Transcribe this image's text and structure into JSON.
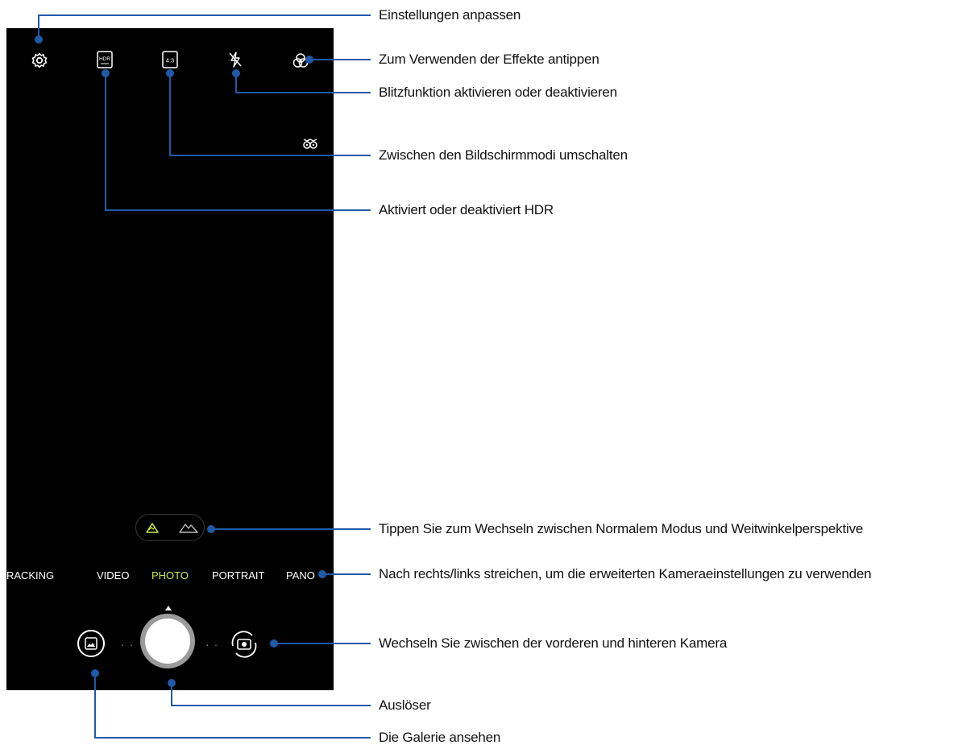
{
  "colors": {
    "screen": "#000000",
    "accent_mode": "#c6e84c",
    "callout": "#1f5aa8"
  },
  "icons": {
    "settings": "gear-icon",
    "hdr": "hdr-auto-icon",
    "ratio": "aspect-ratio-icon",
    "flash": "flash-off-icon",
    "effects": "effects-icon",
    "owl": "owl-icon",
    "lens_normal": "mountain-normal-icon",
    "lens_wide": "mountain-wide-icon",
    "gallery": "gallery-icon",
    "shutter": "shutter-icon",
    "switch": "switch-camera-icon"
  },
  "camera": {
    "ratio_label": "4:3",
    "hdr_label": "HDR",
    "modes": [
      "TRACKING",
      "VIDEO",
      "PHOTO",
      "PORTRAIT",
      "PANO"
    ],
    "active_mode": "PHOTO"
  },
  "callouts": {
    "settings": "Einstellungen anpassen",
    "effects": "Zum Verwenden der Effekte antippen",
    "flash": "Blitzfunktion aktivieren oder deaktivieren",
    "ratio": "Zwischen den Bildschirmmodi umschalten",
    "hdr": "Aktiviert oder deaktiviert HDR",
    "lens": "Tippen Sie zum Wechseln zwischen Normalem Modus und Weitwinkelperspektive",
    "swipe": "Nach rechts/links streichen, um die erweiterten Kameraeinstellungen zu verwenden",
    "switch": "Wechseln Sie zwischen der vorderen und hinteren Kamera",
    "shutter": "Auslöser",
    "gallery": "Die Galerie ansehen"
  }
}
